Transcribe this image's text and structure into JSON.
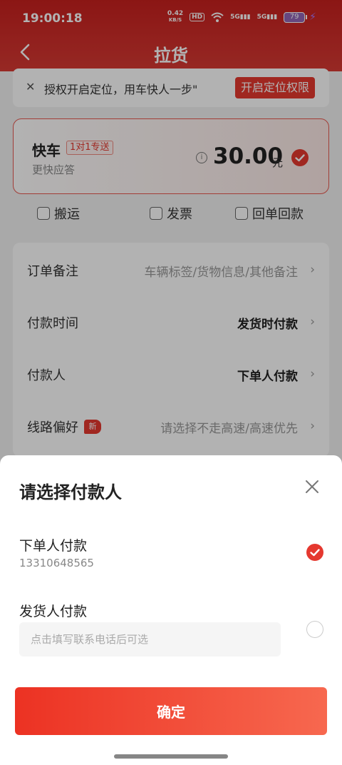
{
  "colors": {
    "brand": "#e5382f",
    "header": "#c8201e"
  },
  "status_bar": {
    "time": "19:00:18",
    "net_speed": "0.42",
    "net_unit": "KB/S",
    "hd": "HD",
    "sig1": "5G",
    "sig2": "5G",
    "battery": "79"
  },
  "header": {
    "title": "拉货",
    "back_icon": "chevron-left-icon"
  },
  "location_bar": {
    "text": "授权开启定位，用车快人一步\"",
    "button": "开启定位权限"
  },
  "vehicle": {
    "name": "快车",
    "tag": "1对1专送",
    "subtitle": "更快应答",
    "price": "30.00",
    "unit": "元",
    "selected": true
  },
  "options": [
    {
      "label": "搬运"
    },
    {
      "label": "发票"
    },
    {
      "label": "回单回款"
    }
  ],
  "rows": [
    {
      "label": "订单备注",
      "value": "车辆标签/货物信息/其他备注"
    },
    {
      "label": "付款时间",
      "value": "发货时付款"
    },
    {
      "label": "付款人",
      "value": "下单人付款"
    },
    {
      "label": "线路偏好",
      "value": "请选择不走高速/高速优先",
      "badge": "新"
    }
  ],
  "sheet": {
    "title": "请选择付款人",
    "payers": [
      {
        "name": "下单人付款",
        "phone": "13310648565",
        "selected": true
      },
      {
        "name": "发货人付款",
        "placeholder": "点击填写联系电话后可选",
        "selected": false
      }
    ],
    "confirm": "确定"
  }
}
